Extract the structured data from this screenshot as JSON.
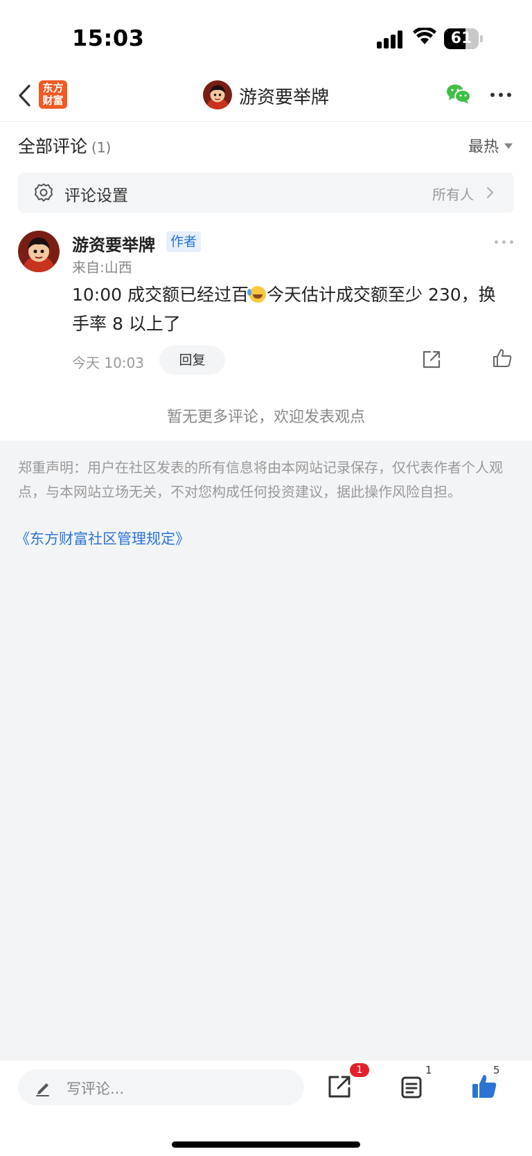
{
  "status_bar": {
    "time": "15:03",
    "battery": "61",
    "battery_level": 0.61
  },
  "nav": {
    "logo_line1": "东方",
    "logo_line2": "财富",
    "title": "游资要举牌"
  },
  "comments_header": {
    "title": "全部评论",
    "count": "(1)",
    "sort_label": "最热"
  },
  "settings": {
    "label": "评论设置",
    "value": "所有人"
  },
  "comment": {
    "author": "游资要举牌",
    "badge": "作者",
    "location": "来自:山西",
    "text_before_emoji": "10:00 成交额已经过百",
    "text_after_emoji": "今天估计成交额至少 230，换手率 8 以上了",
    "time": "今天 10:03",
    "reply_label": "回复"
  },
  "no_more_text": "暂无更多评论，欢迎发表观点",
  "disclaimer": "郑重声明：用户在社区发表的所有信息将由本网站记录保存，仅代表作者个人观点，与本网站立场无关，不对您构成任何投资建议，据此操作风险自担。",
  "rules_link": "《东方财富社区管理规定》",
  "bottom_bar": {
    "placeholder": "写评论...",
    "share_badge": "1",
    "doc_count": "1",
    "like_count": "5"
  },
  "colors": {
    "accent_blue": "#2b74d6",
    "brand_orange": "#f05a23",
    "badge_red": "#e4202c",
    "wechat_green": "#3fbf47"
  }
}
